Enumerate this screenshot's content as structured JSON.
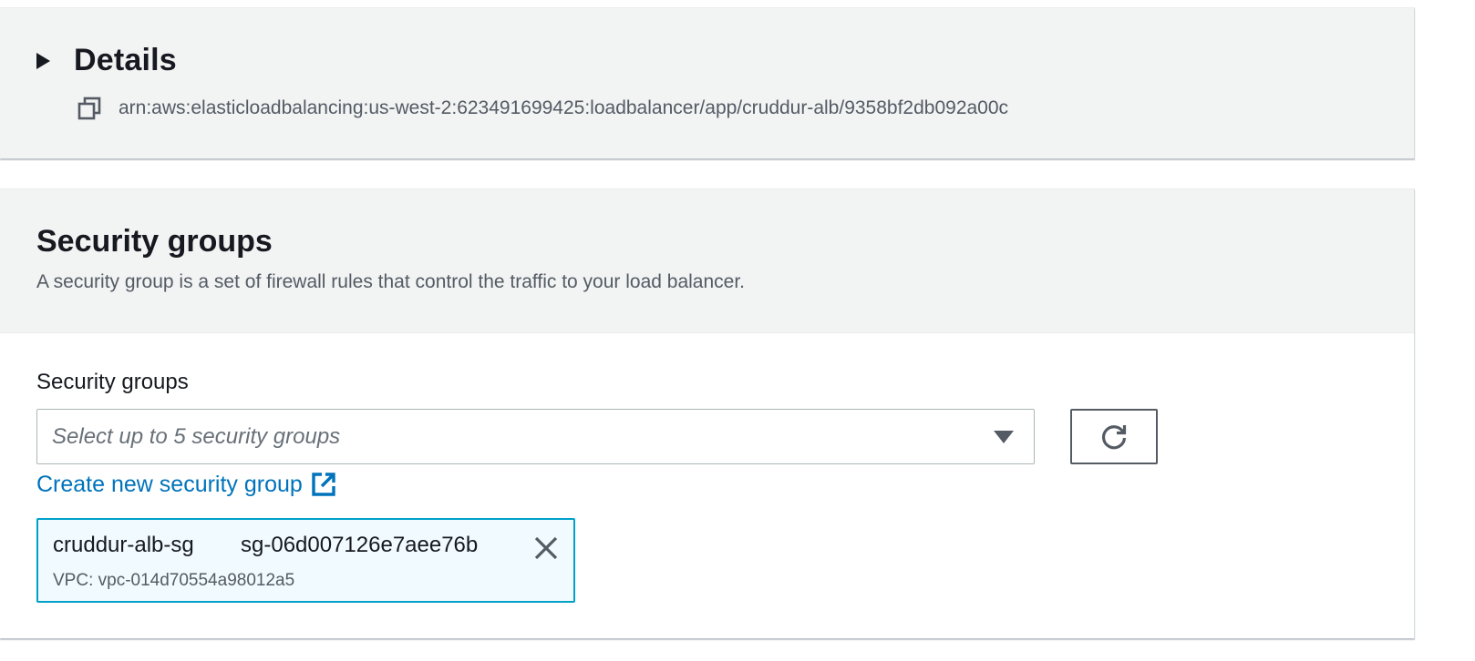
{
  "details": {
    "title": "Details",
    "expanded": false,
    "toggle_icon": "caret-right-icon",
    "copy_icon": "copy-icon",
    "arn": "arn:aws:elasticloadbalancing:us-west-2:623491699425:loadbalancer/app/cruddur-alb/9358bf2db092a00c"
  },
  "security_groups": {
    "title": "Security groups",
    "description": "A security group is a set of firewall rules that control the traffic to your load balancer.",
    "field_label": "Security groups",
    "select": {
      "placeholder": "Select up to 5 security groups",
      "icon": "caret-down-icon"
    },
    "refresh_button": {
      "icon": "refresh-icon"
    },
    "create_link": {
      "label": "Create new security group",
      "icon": "external-link-icon"
    },
    "selected": [
      {
        "name": "cruddur-alb-sg",
        "id": "sg-06d007126e7aee76b",
        "vpc": "VPC: vpc-014d70554a98012a5",
        "dismiss_icon": "close-icon"
      }
    ]
  },
  "colors": {
    "panel_header_bg": "#f2f3f3",
    "text": "#16191f",
    "secondary_text": "#545b64",
    "link": "#0073bb",
    "token_bg": "#f1faff",
    "token_border": "#00a1c9"
  }
}
